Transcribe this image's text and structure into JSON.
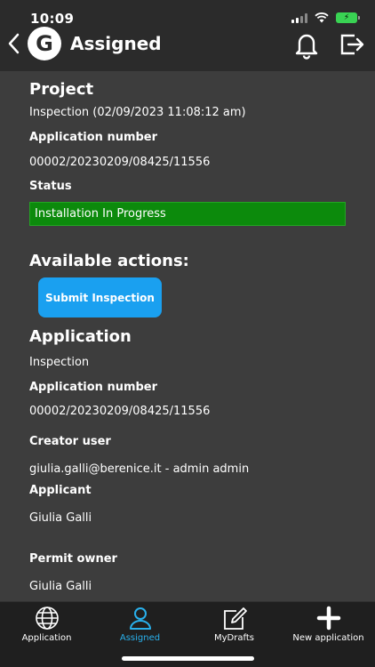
{
  "status_bar": {
    "time": "10:09"
  },
  "header": {
    "title": "Assigned",
    "logo_letter": "G"
  },
  "project": {
    "heading": "Project",
    "type": "Inspection (02/09/2023 11:08:12 am)",
    "app_number_label": "Application number",
    "app_number": "00002/20230209/08425/11556",
    "status_label": "Status",
    "status_value": "Installation In Progress",
    "status_color": "#0c8a0c"
  },
  "actions": {
    "heading": "Available actions:",
    "submit_label": "Submit Inspection",
    "button_color": "#1aa0f0"
  },
  "application": {
    "heading": "Application",
    "type": "Inspection",
    "app_number_label": "Application number",
    "app_number": "00002/20230209/08425/11556",
    "creator_label": "Creator user",
    "creator": "giulia.galli@berenice.it - admin admin",
    "applicant_label": "Applicant",
    "applicant": "Giulia Galli",
    "owner_label": "Permit owner",
    "owner": "Giulia Galli"
  },
  "tabs": [
    {
      "label": "Application",
      "icon": "globe-icon"
    },
    {
      "label": "Assigned",
      "icon": "person-icon",
      "active": true
    },
    {
      "label": "MyDrafts",
      "icon": "edit-icon"
    },
    {
      "label": "New application",
      "icon": "plus-icon"
    }
  ],
  "accent": "#29b0ec"
}
